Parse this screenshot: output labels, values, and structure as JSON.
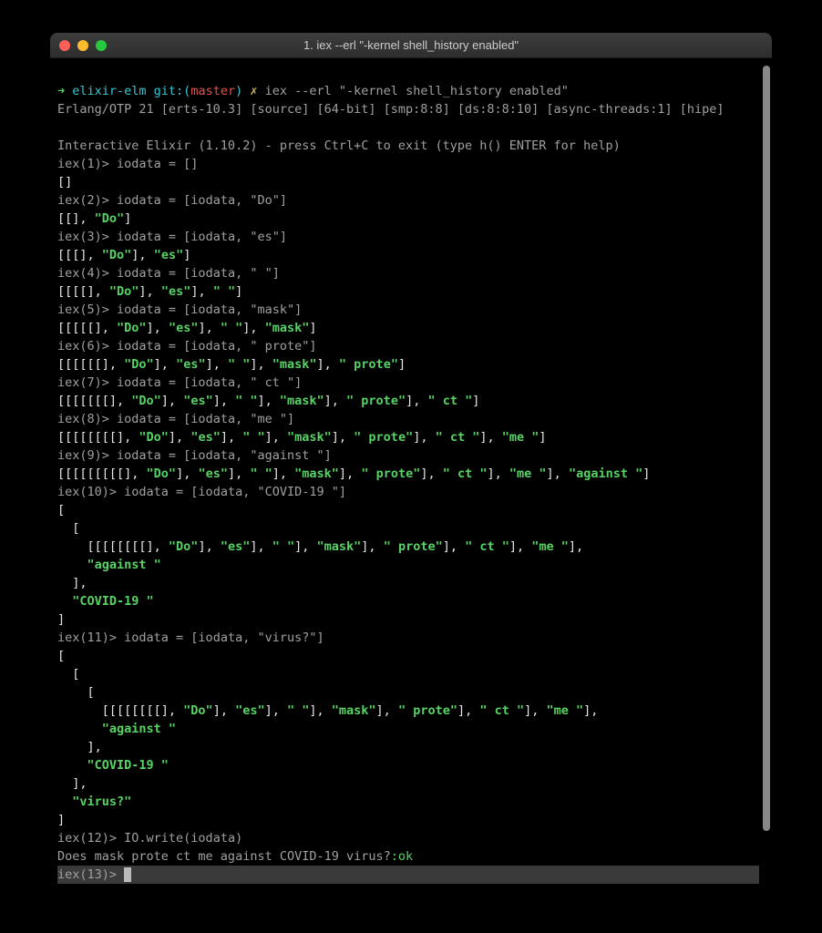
{
  "window": {
    "title": "1. iex --erl \"-kernel shell_history enabled\""
  },
  "prompt": {
    "arrow": "➜ ",
    "dir": "elixir-elm",
    "git_label": " git:(",
    "branch": "master",
    "git_close": ")",
    "dirty": " ✗ ",
    "cmd": "iex --erl \"-kernel shell_history enabled\""
  },
  "banner": {
    "erlang": "Erlang/OTP 21 [erts-10.3] [source] [64-bit] [smp:8:8] [ds:8:8:10] [async-threads:1] [hipe]",
    "elixir": "Interactive Elixir (1.10.2) - press Ctrl+C to exit (type h() ENTER for help)"
  },
  "iex": {
    "p1": "iex(1)> ",
    "in1": "iodata = []",
    "out1": "[]",
    "p2": "iex(2)> ",
    "in2": "iodata = [iodata, \"Do\"]",
    "out2a": "[[], ",
    "out2b": "\"Do\"",
    "out2c": "]",
    "p3": "iex(3)> ",
    "in3": "iodata = [iodata, \"es\"]",
    "out3a": "[[[], ",
    "out3b": "\"Do\"",
    "out3c": "], ",
    "out3d": "\"es\"",
    "out3e": "]",
    "p4": "iex(4)> ",
    "in4": "iodata = [iodata, \" \"]",
    "out4a": "[[[[], ",
    "out4b": "\"Do\"",
    "out4c": "], ",
    "out4d": "\"es\"",
    "out4e": "], ",
    "out4f": "\" \"",
    "out4g": "]",
    "p5": "iex(5)> ",
    "in5": "iodata = [iodata, \"mask\"]",
    "out5a": "[[[[[], ",
    "out5b": "\"Do\"",
    "out5c": "], ",
    "out5d": "\"es\"",
    "out5e": "], ",
    "out5f": "\" \"",
    "out5g": "], ",
    "out5h": "\"mask\"",
    "out5i": "]",
    "p6": "iex(6)> ",
    "in6": "iodata = [iodata, \" prote\"]",
    "out6a": "[[[[[[], ",
    "out6b": "\"Do\"",
    "out6c": "], ",
    "out6d": "\"es\"",
    "out6e": "], ",
    "out6f": "\" \"",
    "out6g": "], ",
    "out6h": "\"mask\"",
    "out6i": "], ",
    "out6j": "\" prote\"",
    "out6k": "]",
    "p7": "iex(7)> ",
    "in7": "iodata = [iodata, \" ct \"]",
    "out7a": "[[[[[[[], ",
    "out7b": "\"Do\"",
    "out7c": "], ",
    "out7d": "\"es\"",
    "out7e": "], ",
    "out7f": "\" \"",
    "out7g": "], ",
    "out7h": "\"mask\"",
    "out7i": "], ",
    "out7j": "\" prote\"",
    "out7k": "], ",
    "out7l": "\" ct \"",
    "out7m": "]",
    "p8": "iex(8)> ",
    "in8": "iodata = [iodata, \"me \"]",
    "out8a": "[[[[[[[[], ",
    "out8b": "\"Do\"",
    "out8c": "], ",
    "out8d": "\"es\"",
    "out8e": "], ",
    "out8f": "\" \"",
    "out8g": "], ",
    "out8h": "\"mask\"",
    "out8i": "], ",
    "out8j": "\" prote\"",
    "out8k": "], ",
    "out8l": "\" ct \"",
    "out8m": "], ",
    "out8n": "\"me \"",
    "out8o": "]",
    "p9": "iex(9)> ",
    "in9": "iodata = [iodata, \"against \"]",
    "out9a": "[[[[[[[[[], ",
    "out9b": "\"Do\"",
    "out9c": "], ",
    "out9d": "\"es\"",
    "out9e": "], ",
    "out9f": "\" \"",
    "out9g": "], ",
    "out9h": "\"mask\"",
    "out9i": "], ",
    "out9j": "\" prote\"",
    "out9k": "], ",
    "out9l": "\" ct \"",
    "out9m": "], ",
    "out9n": "\"me \"",
    "out9o": "], ",
    "out9p": "\"against \"",
    "out9q": "]",
    "p10": "iex(10)> ",
    "in10": "iodata = [iodata, \"COVID-19 \"]",
    "out10_l1": "[",
    "out10_l2": "  [",
    "out10_l3a": "    [[[[[[[[], ",
    "out10_l3b": "\"Do\"",
    "out10_l3c": "], ",
    "out10_l3d": "\"es\"",
    "out10_l3e": "], ",
    "out10_l3f": "\" \"",
    "out10_l3g": "], ",
    "out10_l3h": "\"mask\"",
    "out10_l3i": "], ",
    "out10_l3j": "\" prote\"",
    "out10_l3k": "], ",
    "out10_l3l": "\" ct \"",
    "out10_l3m": "], ",
    "out10_l3n": "\"me \"",
    "out10_l3o": "],",
    "out10_l4": "    \"against \"",
    "out10_l5": "  ],",
    "out10_l6": "  \"COVID-19 \"",
    "out10_l7": "]",
    "p11": "iex(11)> ",
    "in11": "iodata = [iodata, \"virus?\"]",
    "out11_l1": "[",
    "out11_l2": "  [",
    "out11_l3": "    [",
    "out11_l4a": "      [[[[[[[[], ",
    "out11_l4b": "\"Do\"",
    "out11_l4c": "], ",
    "out11_l4d": "\"es\"",
    "out11_l4e": "], ",
    "out11_l4f": "\" \"",
    "out11_l4g": "], ",
    "out11_l4h": "\"mask\"",
    "out11_l4i": "], ",
    "out11_l4j": "\" prote\"",
    "out11_l4k": "], ",
    "out11_l4l": "\" ct \"",
    "out11_l4m": "], ",
    "out11_l4n": "\"me \"",
    "out11_l4o": "],",
    "out11_l5": "      \"against \"",
    "out11_l6": "    ],",
    "out11_l7": "    \"COVID-19 \"",
    "out11_l8": "  ],",
    "out11_l9": "  \"virus?\"",
    "out11_l10": "]",
    "p12": "iex(12)> ",
    "in12": "IO.write(iodata)",
    "out12a": "Does mask prote ct me against COVID-19 virus?",
    "out12b": ":ok",
    "p13": "iex(13)> "
  }
}
